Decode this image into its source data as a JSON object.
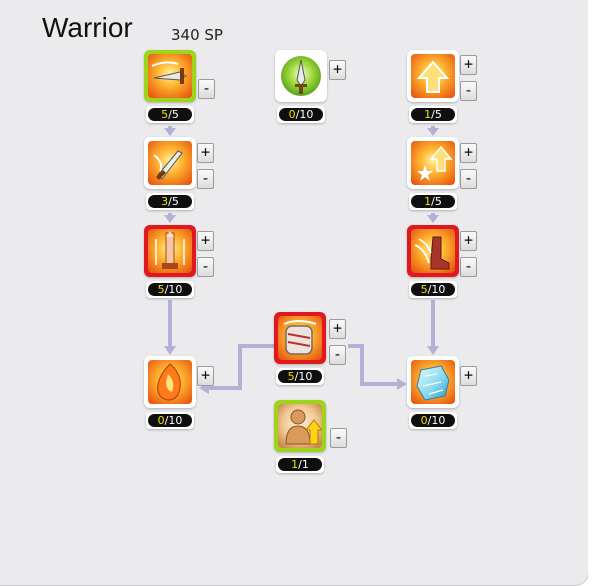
{
  "header": {
    "class_name": "Warrior",
    "skill_points": "340 SP"
  },
  "buttons": {
    "plus": "+",
    "minus": "-"
  },
  "colors": {
    "selected_max": "#9fd41c",
    "selected_active": "#e01820",
    "connector": "#b5b0d6",
    "level_current": "#f0e000"
  },
  "skills": [
    {
      "id": "s1",
      "icon": "sword-slash-icon",
      "theme": "orange",
      "level": "5",
      "max": "5",
      "state": "maxed",
      "plus": false,
      "minus": true
    },
    {
      "id": "s2",
      "icon": "sword-green-aura-icon",
      "theme": "green",
      "level": "0",
      "max": "10",
      "state": "none",
      "plus": true,
      "minus": false
    },
    {
      "id": "s3",
      "icon": "up-arrow-icon",
      "theme": "orange",
      "level": "1",
      "max": "5",
      "state": "none",
      "plus": true,
      "minus": true
    },
    {
      "id": "s4",
      "icon": "sword-strike-icon",
      "theme": "orange",
      "level": "3",
      "max": "5",
      "state": "none",
      "plus": true,
      "minus": true
    },
    {
      "id": "s5",
      "icon": "star-arrow-icon",
      "theme": "orange",
      "level": "1",
      "max": "5",
      "state": "none",
      "plus": true,
      "minus": true
    },
    {
      "id": "s6",
      "icon": "sword-pillar-icon",
      "theme": "orange",
      "level": "5",
      "max": "10",
      "state": "active",
      "plus": true,
      "minus": true
    },
    {
      "id": "s7",
      "icon": "boot-kick-icon",
      "theme": "orange",
      "level": "5",
      "max": "10",
      "state": "active",
      "plus": true,
      "minus": true
    },
    {
      "id": "s8",
      "icon": "fire-crystal-icon",
      "theme": "orange",
      "level": "0",
      "max": "10",
      "state": "none",
      "plus": true,
      "minus": false
    },
    {
      "id": "s9",
      "icon": "bandaged-fist-icon",
      "theme": "orange",
      "level": "5",
      "max": "10",
      "state": "active",
      "plus": true,
      "minus": true
    },
    {
      "id": "s10",
      "icon": "ice-crystal-icon",
      "theme": "orange",
      "level": "0",
      "max": "10",
      "state": "none",
      "plus": true,
      "minus": false
    },
    {
      "id": "s11",
      "icon": "figure-arrow-up-icon",
      "theme": "tan",
      "level": "1",
      "max": "1",
      "state": "maxed",
      "plus": false,
      "minus": true
    }
  ]
}
